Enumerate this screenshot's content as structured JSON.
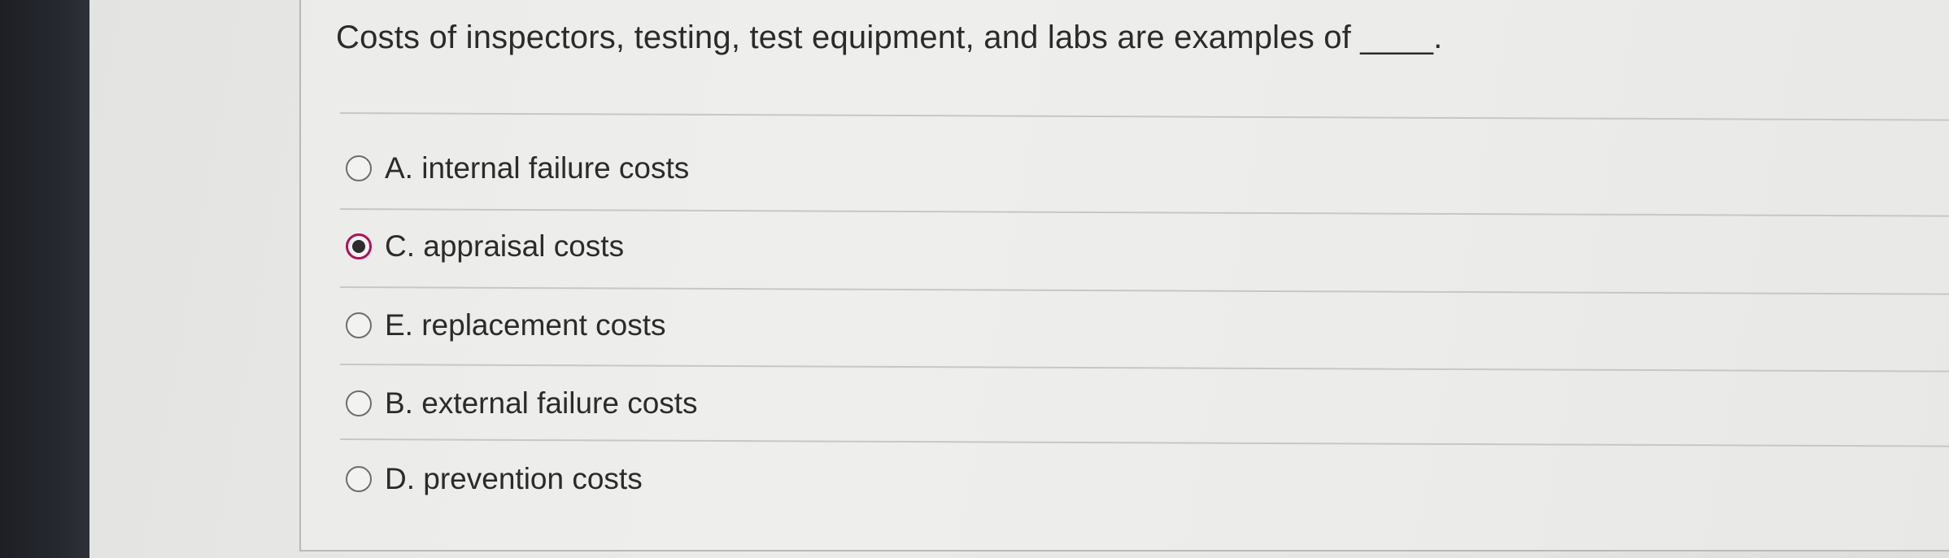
{
  "question": {
    "text": "Costs of inspectors, testing, test equipment, and labs are examples of ____."
  },
  "options": [
    {
      "label": "A. internal failure costs",
      "selected": false
    },
    {
      "label": "C. appraisal costs",
      "selected": true
    },
    {
      "label": "E. replacement costs",
      "selected": false
    },
    {
      "label": "B. external failure costs",
      "selected": false
    },
    {
      "label": "D. prevention costs",
      "selected": false
    }
  ],
  "colors": {
    "selected_ring": "#b0105a",
    "text": "#2b2b2b",
    "bezel": "#1d1f24"
  },
  "icons": {
    "unselected": "radio-unselected-icon",
    "selected": "radio-selected-icon"
  }
}
